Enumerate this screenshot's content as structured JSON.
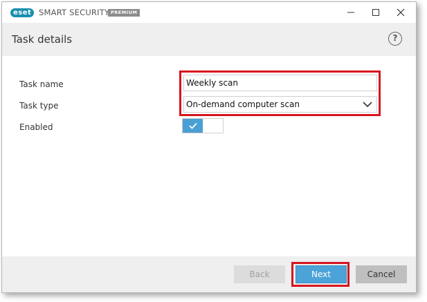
{
  "window": {
    "logo_text": "eset",
    "product_name": "SMART SECURITY",
    "edition_badge": "PREMIUM"
  },
  "header": {
    "title": "Task details",
    "help_label": "?"
  },
  "form": {
    "task_name_label": "Task name",
    "task_name_value": "Weekly scan",
    "task_type_label": "Task type",
    "task_type_value": "On-demand computer scan",
    "enabled_label": "Enabled",
    "enabled_state": true
  },
  "footer": {
    "back_label": "Back",
    "next_label": "Next",
    "cancel_label": "Cancel"
  },
  "colors": {
    "accent": "#4ba3d8",
    "highlight": "#d7141c",
    "logo": "#1a8fb0"
  },
  "icons": {
    "minimize": "minimize-icon",
    "maximize": "maximize-icon",
    "close": "close-icon",
    "dropdown": "chevron-down-icon",
    "toggle": "checkmark-icon"
  }
}
